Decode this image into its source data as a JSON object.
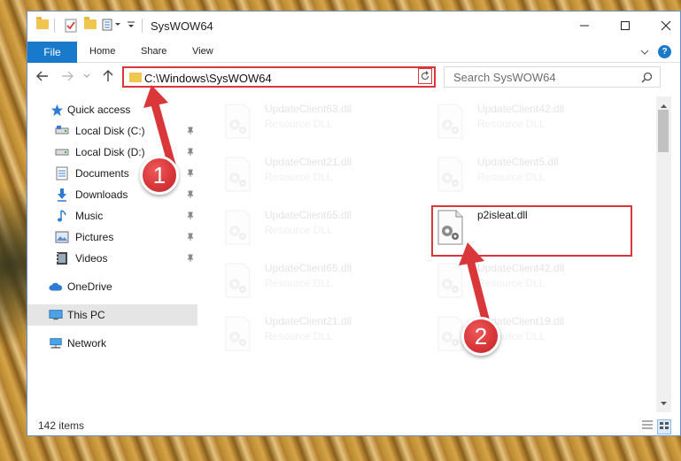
{
  "window": {
    "title": "SysWOW64"
  },
  "ribbon": {
    "tabs": [
      "File",
      "Home",
      "Share",
      "View"
    ],
    "help_label": "?"
  },
  "address": {
    "path": "C:\\Windows\\SysWOW64"
  },
  "search": {
    "placeholder": "Search SysWOW64"
  },
  "nav": {
    "items": [
      {
        "label": "Quick access",
        "icon": "star-icon"
      },
      {
        "label": "Local Disk (C:)",
        "icon": "drive-icon"
      },
      {
        "label": "Local Disk (D:)",
        "icon": "drive-icon"
      },
      {
        "label": "Documents",
        "icon": "documents-icon"
      },
      {
        "label": "Downloads",
        "icon": "download-icon"
      },
      {
        "label": "Music",
        "icon": "music-icon"
      },
      {
        "label": "Pictures",
        "icon": "pictures-icon"
      },
      {
        "label": "Videos",
        "icon": "videos-icon"
      },
      {
        "label": "OneDrive",
        "icon": "cloud-icon"
      },
      {
        "label": "This PC",
        "icon": "computer-icon"
      },
      {
        "label": "Network",
        "icon": "network-icon"
      }
    ]
  },
  "files": [
    {
      "name": "UpdateClient63.dll",
      "type": "Resource DLL"
    },
    {
      "name": "UpdateClient42.dll",
      "type": "Resource DLL"
    },
    {
      "name": "UpdateClient21.dll",
      "type": "Resource DLL"
    },
    {
      "name": "UpdateClient5.dll",
      "type": "Resource DLL"
    },
    {
      "name": "UpdateClient65.dll",
      "type": "Resource DLL"
    },
    {
      "name": "p2isleat.dll",
      "type": ""
    },
    {
      "name": "UpdateClient65.dll",
      "type": "Resource DLL"
    },
    {
      "name": "UpdateClient42.dll",
      "type": "Resource DLL"
    },
    {
      "name": "UpdateClient21.dll",
      "type": "Resource DLL"
    },
    {
      "name": "UpdateClient19.dll",
      "type": "Resource DLL"
    }
  ],
  "status": {
    "item_count": "142 items"
  },
  "annotations": {
    "step1": "1",
    "step2": "2"
  },
  "colors": {
    "accent": "#1979ca",
    "highlight": "#d9373a",
    "selected_nav": "#e5e5e5"
  }
}
